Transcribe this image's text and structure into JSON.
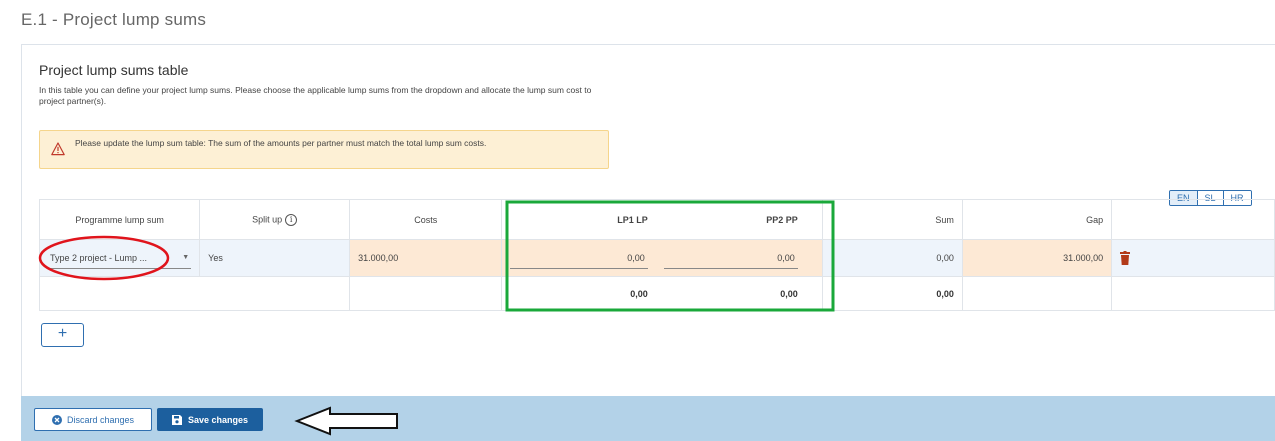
{
  "page": {
    "title": "E.1 - Project lump sums"
  },
  "section": {
    "title": "Project lump sums table",
    "description": "In this table you can define your project lump sums. Please choose the applicable lump sums from the dropdown and allocate the lump sum cost to project partner(s)."
  },
  "warning": {
    "icon": "warning-triangle-icon",
    "text": "Please update the lump sum table: The sum of the amounts per partner must match the total lump sum costs."
  },
  "language_switch": {
    "options": [
      "EN",
      "SL",
      "HR"
    ],
    "selected": "EN"
  },
  "table": {
    "headers": {
      "lump_sum": "Programme lump sum",
      "split_up": "Split up",
      "costs": "Costs",
      "lp1": "LP1 LP",
      "pp2": "PP2 PP",
      "sum": "Sum",
      "gap": "Gap"
    },
    "row": {
      "lump_sum": "Type 2 project - Lump ...",
      "split_up": "Yes",
      "costs": "31.000,00",
      "lp1": "0,00",
      "pp2": "0,00",
      "sum": "0,00",
      "gap": "31.000,00"
    },
    "totals": {
      "lp1": "0,00",
      "pp2": "0,00",
      "sum": "0,00"
    }
  },
  "actions": {
    "add": "+",
    "discard": "Discard changes",
    "save": "Save changes"
  },
  "colors": {
    "primary": "#1c5f9e",
    "warning_bg": "#fdf0d5",
    "highlight_cell": "#fde9d5",
    "annotation_green": "#1aa83a",
    "annotation_red": "#e0141c",
    "footer_bg": "#b3d2e8",
    "delete_icon": "#b23a1a"
  }
}
